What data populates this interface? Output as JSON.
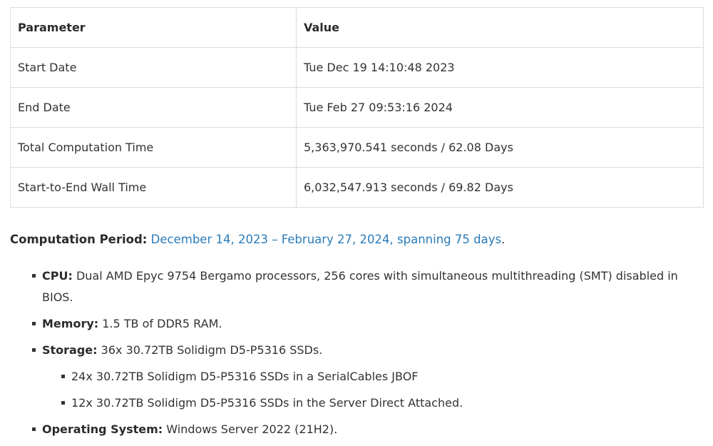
{
  "table": {
    "headers": [
      "Parameter",
      "Value"
    ],
    "rows": [
      {
        "param": "Start Date",
        "value": "Tue Dec 19 14:10:48 2023"
      },
      {
        "param": "End Date",
        "value": "Tue Feb 27 09:53:16 2024"
      },
      {
        "param": "Total Computation Time",
        "value": "5,363,970.541 seconds / 62.08 Days"
      },
      {
        "param": "Start-to-End Wall Time",
        "value": "6,032,547.913 seconds / 69.82 Days"
      }
    ]
  },
  "period": {
    "label": "Computation Period:",
    "link_text": "December 14, 2023 – February 27, 2024, spanning 75 days",
    "suffix": "."
  },
  "specs": {
    "cpu": {
      "label": "CPU:",
      "text": "Dual AMD Epyc 9754 Bergamo processors, 256 cores with simultaneous multithreading (SMT) disabled in BIOS."
    },
    "memory": {
      "label": "Memory:",
      "text": "1.5 TB of DDR5 RAM."
    },
    "storage": {
      "label": "Storage:",
      "text": "36x 30.72TB Solidigm D5-P5316 SSDs.",
      "sub": [
        "24x 30.72TB Solidigm D5-P5316 SSDs in a SerialCables JBOF",
        "12x 30.72TB Solidigm D5-P5316 SSDs in the Server Direct Attached."
      ]
    },
    "os": {
      "label": "Operating System:",
      "text": "Windows Server 2022 (21H2)."
    }
  },
  "colors": {
    "link": "#2a7bb8",
    "border": "#dcdcdc",
    "text": "#333333"
  }
}
